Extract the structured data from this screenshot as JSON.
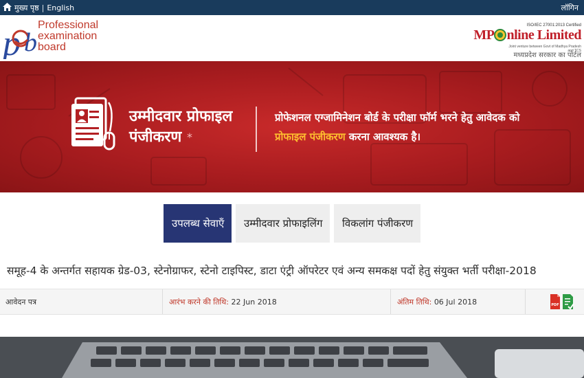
{
  "topbar": {
    "home_label": "मुख्य पृष्ठ",
    "english_label": "English",
    "login_label": "लॉगिन"
  },
  "header": {
    "peb_line1": "Professional",
    "peb_line2": "examination",
    "peb_line3": "board",
    "mp_cert": "ISO/IEC 27001:2013 Certified",
    "mp_title_prefix": "MP",
    "mp_title_rest": "nline Limited",
    "mp_sub": "Joint venture between Govt of Madhya Pradesh and TCS",
    "mp_govt": "मध्यप्रदेश सरकार का पोर्टल"
  },
  "banner": {
    "title_line1": "उम्मीदवार प्रोफाइल",
    "title_line2": "पंजीकरण",
    "star": "*",
    "desc_line1": "प्रोफेशनल एग्जामिनेशन बोर्ड के परीक्षा फॉर्म भरने हेतु आवेदक को",
    "desc_highlight": "प्रोफाइल पंजीकरण",
    "desc_line2_rest": " करना आवश्यक है।"
  },
  "tabs": [
    {
      "label": "उपलब्ध सेवाएँ",
      "active": true
    },
    {
      "label": "उम्मीदवार प्रोफाइलिंग",
      "active": false
    },
    {
      "label": "विकलांग पंजीकरण",
      "active": false
    }
  ],
  "notice": {
    "title": "समूह-4 के अन्तर्गत सहायक ग्रेड-03, स्टेनोग्राफर, स्टेनो टाइपिस्ट, डाटा एंट्री ऑपरेटर एवं अन्य समकक्ष पदों हेतु संयुक्त भर्ती परीक्षा-2018",
    "type": "आवेदन पत्र",
    "start_label": "आरंभ करने की तिथि:",
    "start_date": "22 Jun 2018",
    "end_label": "अंतिम तिथि:",
    "end_date": "06 Jul 2018",
    "pdf_icon_text": "PDF"
  },
  "colors": {
    "topbar": "#193b5c",
    "banner": "#b31f23",
    "tab_active": "#273574",
    "tab_inactive": "#eeeeee",
    "highlight": "#ffbf2f",
    "label_red": "#c0392b"
  }
}
